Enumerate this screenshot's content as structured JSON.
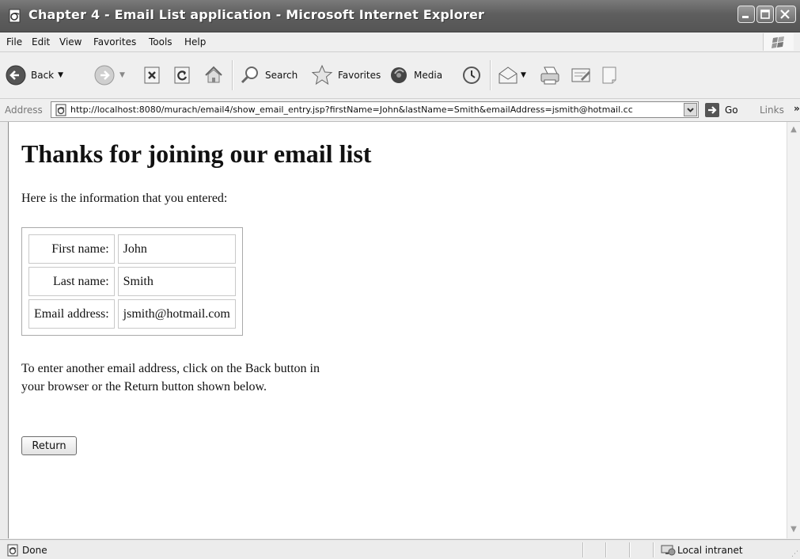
{
  "window": {
    "title": "Chapter 4 - Email List application - Microsoft Internet Explorer"
  },
  "menu": [
    "File",
    "Edit",
    "View",
    "Favorites",
    "Tools",
    "Help"
  ],
  "toolbar": {
    "back_label": "Back",
    "search_label": "Search",
    "favorites_label": "Favorites",
    "media_label": "Media"
  },
  "address": {
    "label": "Address",
    "url": "http://localhost:8080/murach/email4/show_email_entry.jsp?firstName=John&lastName=Smith&emailAddress=jsmith@hotmail.cc",
    "go_label": "Go",
    "links_label": "Links",
    "links_chevron": "»"
  },
  "page": {
    "heading": "Thanks for joining our email list",
    "intro": "Here is the information that you entered:",
    "rows": [
      {
        "label": "First name:",
        "value": "John"
      },
      {
        "label": "Last name:",
        "value": "Smith"
      },
      {
        "label": "Email address:",
        "value": "jsmith@hotmail.com"
      }
    ],
    "instructions": "To enter another email address, click on the Back button in your browser or the Return button shown below.",
    "return_label": "Return"
  },
  "status": {
    "text": "Done",
    "zone": "Local intranet"
  },
  "icons": {
    "back": "back-arrow-icon",
    "forward": "forward-arrow-icon",
    "stop": "stop-icon",
    "refresh": "refresh-icon",
    "home": "home-icon",
    "search": "search-icon",
    "favorites": "favorites-star-icon",
    "media": "media-icon",
    "history": "history-icon",
    "mail": "mail-icon",
    "print": "print-icon",
    "edit": "edit-icon",
    "discuss": "discuss-icon"
  }
}
